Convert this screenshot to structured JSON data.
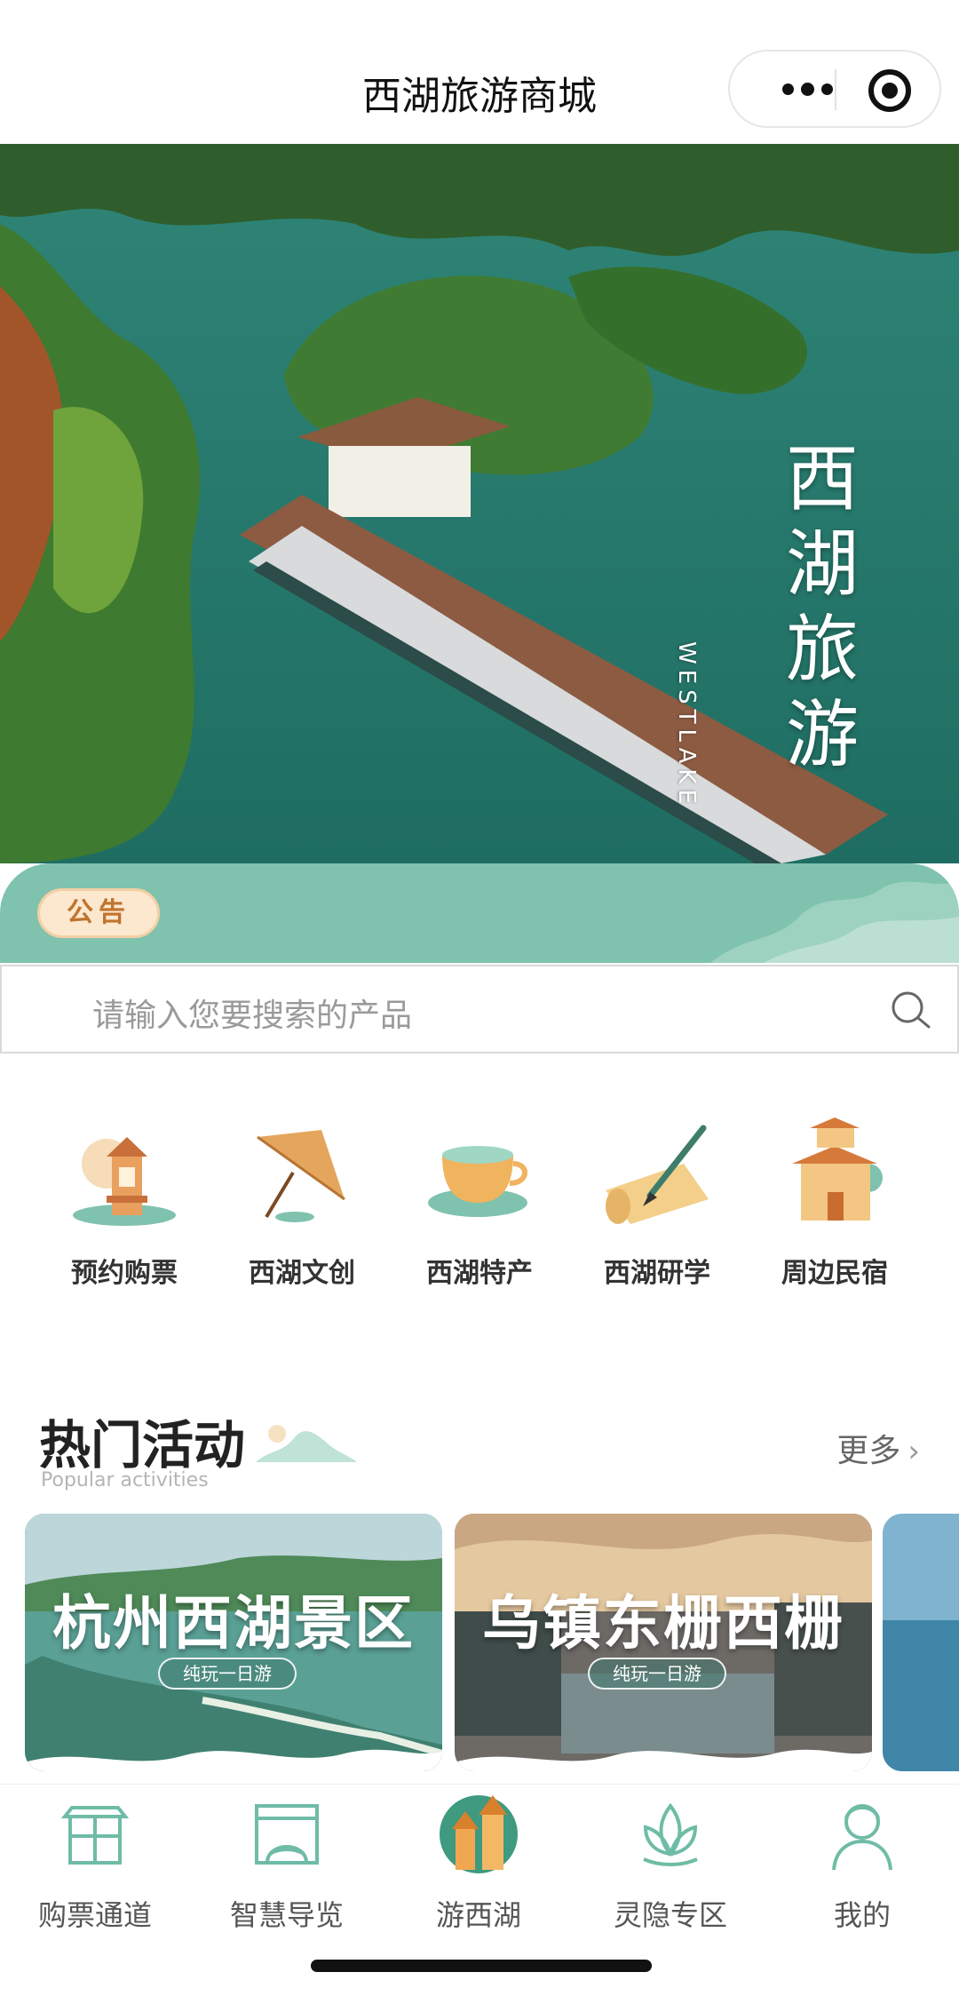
{
  "navbar": {
    "title": "西湖旅游商城"
  },
  "hero": {
    "title_chars": [
      "西",
      "湖",
      "旅",
      "游"
    ],
    "subtitle": "WESTLAKE"
  },
  "notice": {
    "badge": "公告"
  },
  "search": {
    "placeholder": "请输入您要搜索的产品"
  },
  "categories": [
    {
      "label": "预约购票",
      "icon": "pagoda-icon"
    },
    {
      "label": "西湖文创",
      "icon": "umbrella-icon"
    },
    {
      "label": "西湖特产",
      "icon": "tea-cup-icon"
    },
    {
      "label": "西湖研学",
      "icon": "scroll-brush-icon"
    },
    {
      "label": "周边民宿",
      "icon": "house-icon"
    }
  ],
  "hot": {
    "title": "热门活动",
    "subtitle": "Popular activities",
    "more": "更多",
    "cards": [
      {
        "title": "杭州西湖景区",
        "tag": "纯玩一日游"
      },
      {
        "title": "乌镇东栅西栅",
        "tag": "纯玩一日游"
      }
    ]
  },
  "tabbar": {
    "items": [
      {
        "label": "购票通道",
        "icon": "gate-icon"
      },
      {
        "label": "智慧导览",
        "icon": "bridge-icon"
      },
      {
        "label": "游西湖",
        "icon": "west-lake-pagoda-icon"
      },
      {
        "label": "灵隐专区",
        "icon": "lotus-icon"
      },
      {
        "label": "我的",
        "icon": "monk-icon"
      }
    ]
  },
  "colors": {
    "accent_green": "#7fc2ae",
    "tab_icon": "#6fbca6",
    "badge_bg": "#fbe8cf",
    "badge_text": "#c0742e"
  }
}
